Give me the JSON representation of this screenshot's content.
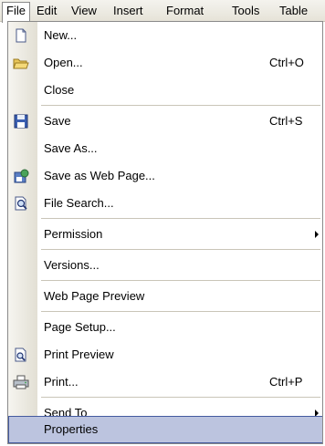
{
  "menubar": {
    "items": [
      {
        "label": "File"
      },
      {
        "label": "Edit"
      },
      {
        "label": "View"
      },
      {
        "label": "Insert"
      },
      {
        "label": "Format"
      },
      {
        "label": "Tools"
      },
      {
        "label": "Table"
      }
    ]
  },
  "file_menu": {
    "items": [
      {
        "label": "New...",
        "icon": "new-document-icon"
      },
      {
        "label": "Open...",
        "shortcut": "Ctrl+O",
        "icon": "open-folder-icon"
      },
      {
        "label": "Close"
      },
      {
        "label": "Save",
        "shortcut": "Ctrl+S",
        "icon": "floppy-disk-icon"
      },
      {
        "label": "Save As..."
      },
      {
        "label": "Save as Web Page...",
        "icon": "web-page-icon"
      },
      {
        "label": "File Search...",
        "icon": "file-search-icon"
      },
      {
        "label": "Permission",
        "submenu": true
      },
      {
        "label": "Versions..."
      },
      {
        "label": "Web Page Preview"
      },
      {
        "label": "Page Setup..."
      },
      {
        "label": "Print Preview",
        "icon": "print-preview-icon"
      },
      {
        "label": "Print...",
        "shortcut": "Ctrl+P",
        "icon": "printer-icon"
      },
      {
        "label": "Send To",
        "submenu": true
      },
      {
        "label": "Properties",
        "highlighted": true
      }
    ]
  },
  "colors": {
    "highlight": "#bcc4df",
    "highlight_border": "#445a9f",
    "gutter": "#e2dfd4",
    "menubar": "#e6e3d8"
  }
}
